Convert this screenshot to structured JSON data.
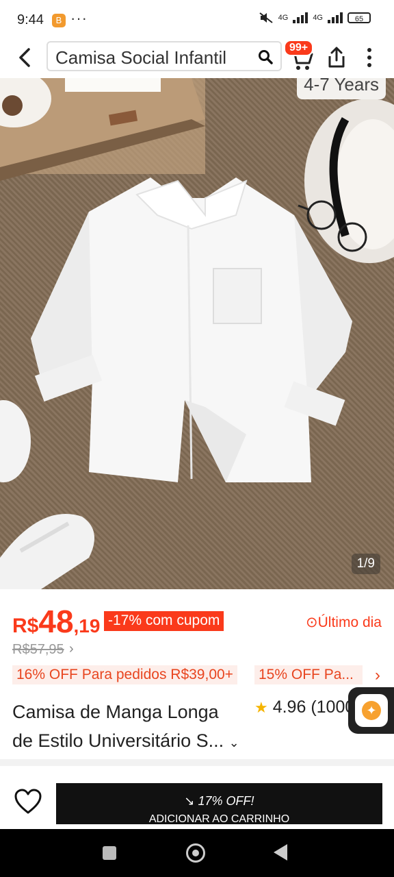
{
  "status_bar": {
    "time": "9:44",
    "dots": "···",
    "net1": "4G",
    "net2": "4G",
    "battery": "65"
  },
  "header": {
    "search_query": "Camisa Social Infantil",
    "cart_badge": "99+"
  },
  "gallery": {
    "size_tag": "4-7 Years",
    "counter": "1/9"
  },
  "price": {
    "currency": "R$",
    "integer": "48",
    "decimal": ",19",
    "discount_label": "-17% com cupom",
    "last_day": "⊙Último dia",
    "original": "R$57,95",
    "original_arrow": "›"
  },
  "coupons": [
    "16% OFF Para pedidos R$39,00+",
    "15% OFF Pa..."
  ],
  "coupon_more": "›",
  "product": {
    "title_line1": "Camisa de Manga Longa",
    "title_line2": "de Estilo Universitário S...",
    "rating": "4.96",
    "reviews": "(1000"
  },
  "bottom": {
    "add_promo": "17% OFF!",
    "add_label": "ADICIONAR AO CARRINHO"
  },
  "colors": {
    "accent": "#fa3a1b",
    "cta": "#111111"
  }
}
